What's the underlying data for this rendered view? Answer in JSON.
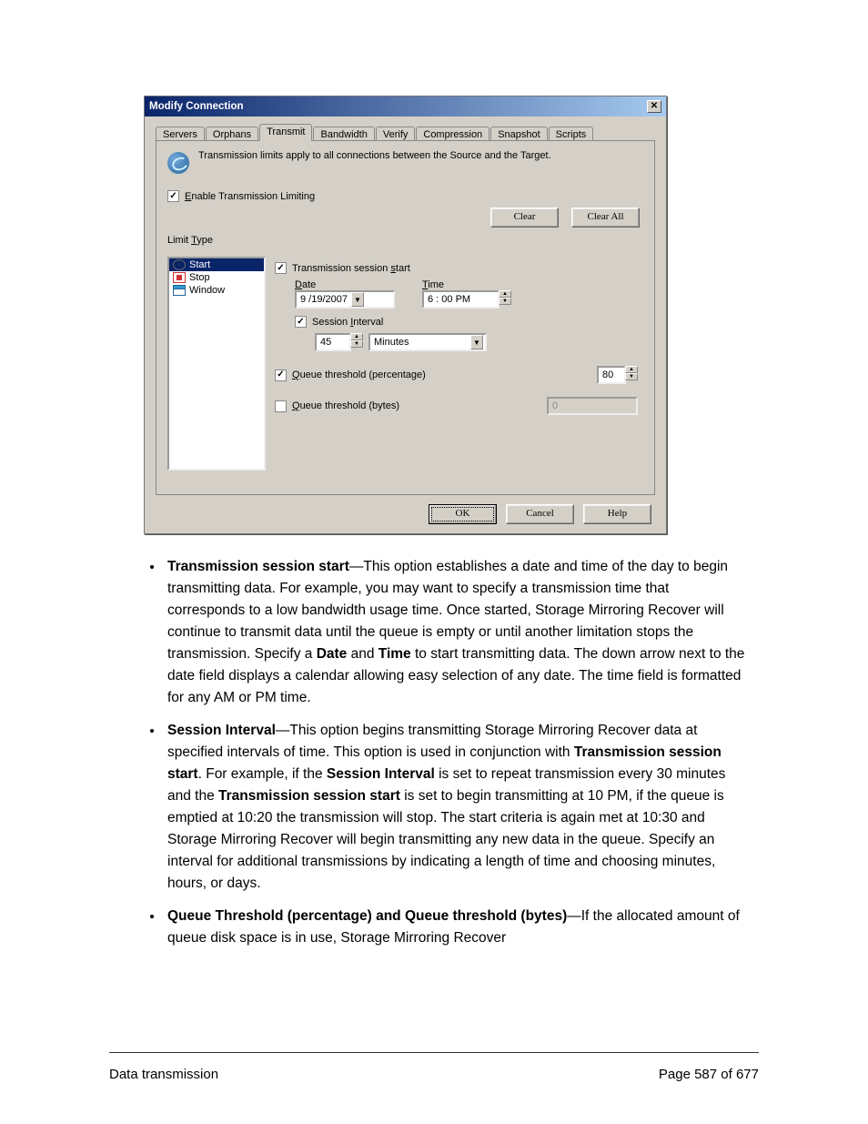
{
  "dialog": {
    "title": "Modify Connection",
    "close_symbol": "✕",
    "tabs": [
      "Servers",
      "Orphans",
      "Transmit",
      "Bandwidth",
      "Verify",
      "Compression",
      "Snapshot",
      "Scripts"
    ],
    "active_tab_index": 2,
    "info_text": "Transmission limits apply to all connections between the Source and the Target.",
    "enable_limiting": {
      "checked": true,
      "label_pre": "E",
      "label_rest": "nable Transmission Limiting"
    },
    "clear_btn": "Clear",
    "clear_all_btn": "Clear All",
    "limit_type_label_pre": "Limit ",
    "limit_type_label_u": "T",
    "limit_type_label_rest": "ype",
    "limit_types": [
      {
        "name": "Start",
        "selected": true
      },
      {
        "name": "Stop",
        "selected": false
      },
      {
        "name": "Window",
        "selected": false
      }
    ],
    "session_start": {
      "checked": true,
      "label_pre": "Transmission session ",
      "label_u": "s",
      "label_rest": "tart"
    },
    "date_label_u": "D",
    "date_label_rest": "ate",
    "date_value": "9 /19/2007",
    "time_label_u": "T",
    "time_label_rest": "ime",
    "time_value": "6 : 00 PM",
    "session_interval": {
      "checked": true,
      "label_pre": "Session ",
      "label_u": "I",
      "label_rest": "nterval"
    },
    "interval_value": "45",
    "interval_unit": "Minutes",
    "queue_pct": {
      "checked": true,
      "label_u": "Q",
      "label_rest": "ueue threshold (percentage)",
      "value": "80"
    },
    "queue_bytes": {
      "checked": false,
      "label_u": "Q",
      "label_rest": "ueue threshold (bytes)",
      "value": "0"
    },
    "ok_btn": "OK",
    "cancel_btn": "Cancel",
    "help_btn": "Help"
  },
  "bullets": [
    {
      "lead": "Transmission session start",
      "body": "—This option establishes a date and time of the day to begin transmitting data. For example, you may want to specify a transmission time that corresponds to a low bandwidth usage time. Once started, Storage Mirroring Recover will continue to transmit data until the queue is empty or until another limitation stops the transmission. Specify a ",
      "bold2": "Date",
      "mid": " and ",
      "bold3": "Time",
      "tail": " to start transmitting data. The down arrow next to the date field displays a calendar allowing easy selection of any date. The time field is formatted for any AM or PM time."
    },
    {
      "lead": "Session Interval",
      "body": "—This option begins transmitting Storage Mirroring Recover data at specified intervals of time. This option is used in conjunction with ",
      "bold2": "Transmission session start",
      "mid": ". For example, if the ",
      "bold3": "Session Interval",
      "tail": " is set to repeat transmission every 30 minutes and the ",
      "bold4": "Transmission session start",
      "tail2": " is set to begin transmitting at 10 PM, if the queue is emptied at 10:20 the transmission will stop. The start criteria is again met at 10:30 and Storage Mirroring Recover will begin transmitting any new data in the queue. Specify an interval for additional transmissions by indicating a length of time and choosing minutes, hours, or days."
    },
    {
      "lead": "Queue Threshold (percentage) and Queue threshold (bytes)",
      "body": "—If the allocated amount of queue disk space is in use, Storage Mirroring Recover"
    }
  ],
  "footer": {
    "left": "Data transmission",
    "right": "Page 587 of 677"
  }
}
